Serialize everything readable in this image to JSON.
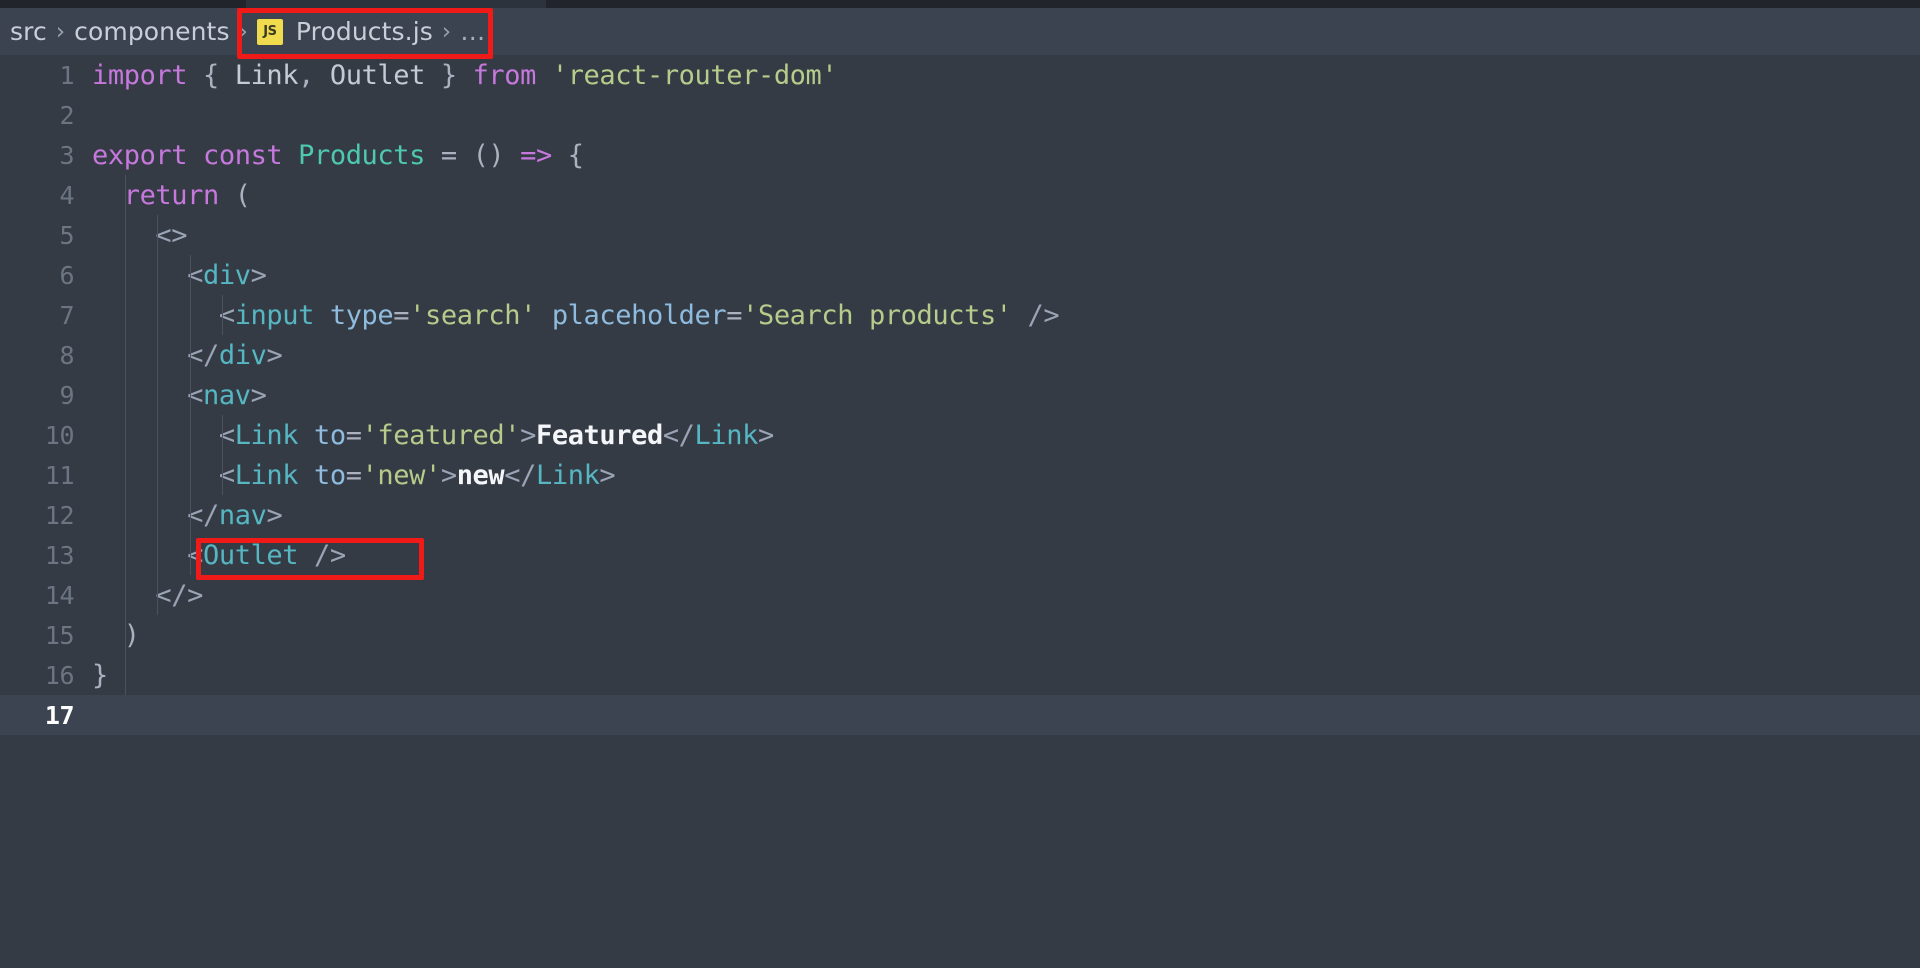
{
  "window": {
    "theme_bg": "#343b45",
    "breadcrumb_bg": "#3b4350",
    "accent_red": "#f01a18",
    "js_badge_color": "#f0db4f"
  },
  "breadcrumb": {
    "items": [
      {
        "label": "src",
        "icon": null
      },
      {
        "label": "components",
        "icon": null
      },
      {
        "label": "Products.js",
        "icon": "js-file-icon"
      },
      {
        "label": "…",
        "icon": null
      }
    ],
    "separator": "›",
    "js_icon_label": "JS"
  },
  "annotations": [
    {
      "name": "breadcrumb-file-highlight",
      "target": "Products.js"
    },
    {
      "name": "outlet-highlight",
      "target": "<Outlet />"
    }
  ],
  "editor": {
    "active_line": 17,
    "lines": [
      {
        "num": "1",
        "text": "import { Link, Outlet } from 'react-router-dom'"
      },
      {
        "num": "2",
        "text": ""
      },
      {
        "num": "3",
        "text": "export const Products = () => {"
      },
      {
        "num": "4",
        "text": "  return ("
      },
      {
        "num": "5",
        "text": "    <>"
      },
      {
        "num": "6",
        "text": "      <div>"
      },
      {
        "num": "7",
        "text": "        <input type='search' placeholder='Search products' />"
      },
      {
        "num": "8",
        "text": "      </div>"
      },
      {
        "num": "9",
        "text": "      <nav>"
      },
      {
        "num": "10",
        "text": "        <Link to='featured'>Featured</Link>"
      },
      {
        "num": "11",
        "text": "        <Link to='new'>new</Link>"
      },
      {
        "num": "12",
        "text": "      </nav>"
      },
      {
        "num": "13",
        "text": "      <Outlet />"
      },
      {
        "num": "14",
        "text": "    </>"
      },
      {
        "num": "15",
        "text": "  )"
      },
      {
        "num": "16",
        "text": "}"
      },
      {
        "num": "17",
        "text": ""
      }
    ]
  }
}
